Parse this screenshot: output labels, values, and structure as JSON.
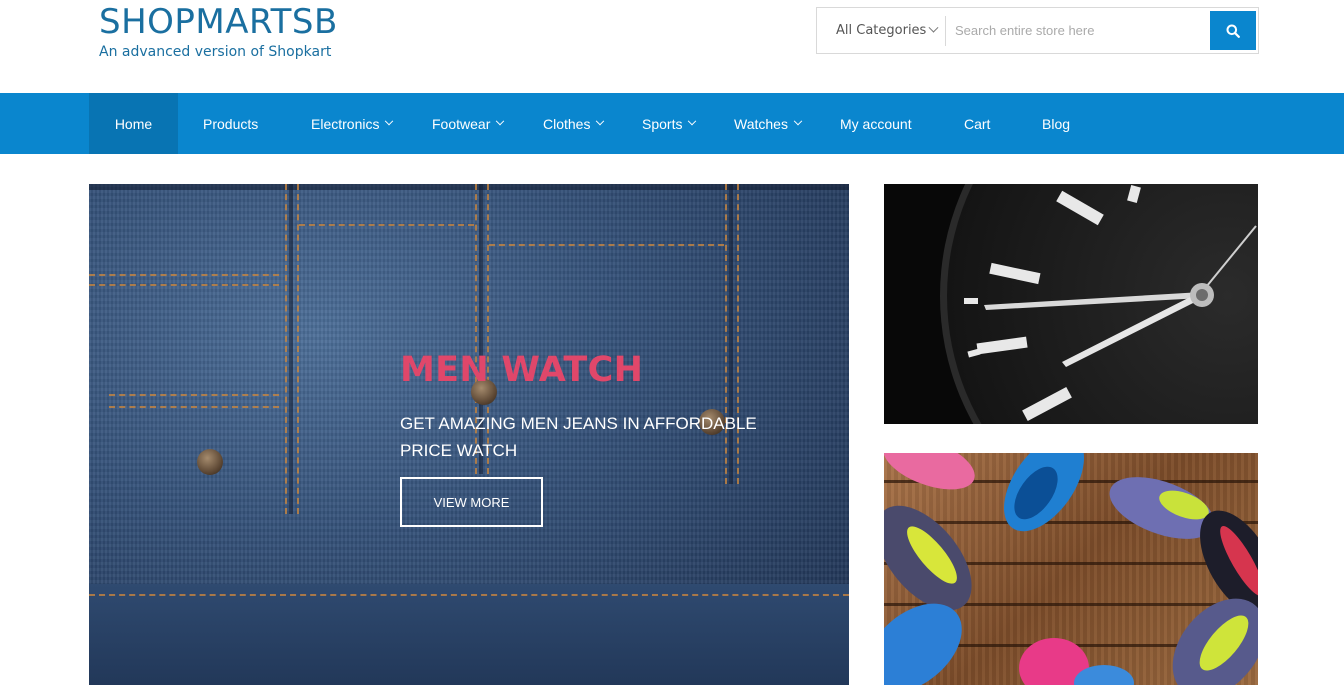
{
  "brand": {
    "title": "SHOPMARTSB",
    "tagline": "An advanced version of Shopkart"
  },
  "search": {
    "category_label": "All Categories",
    "placeholder": "Search entire store here",
    "button_icon": "search-icon"
  },
  "nav": {
    "items": [
      {
        "label": "Home",
        "active": true,
        "dropdown": false
      },
      {
        "label": "Products",
        "dropdown": false
      },
      {
        "label": "Electronics",
        "dropdown": true
      },
      {
        "label": "Footwear",
        "dropdown": true
      },
      {
        "label": "Clothes",
        "dropdown": true
      },
      {
        "label": "Sports",
        "dropdown": true
      },
      {
        "label": "Watches",
        "dropdown": true
      },
      {
        "label": "My account",
        "dropdown": false
      },
      {
        "label": "Cart",
        "dropdown": false
      },
      {
        "label": "Blog",
        "dropdown": false
      }
    ]
  },
  "hero": {
    "title": "MEN WATCH",
    "subtitle": "GET AMAZING MEN JEANS IN AFFORDABLE PRICE WATCH",
    "button_label": "VIEW MORE"
  },
  "colors": {
    "primary": "#0a86ce",
    "nav_active": "#0874b3",
    "brand_text": "#1a6fa0",
    "hero_title": "#e0476a"
  }
}
